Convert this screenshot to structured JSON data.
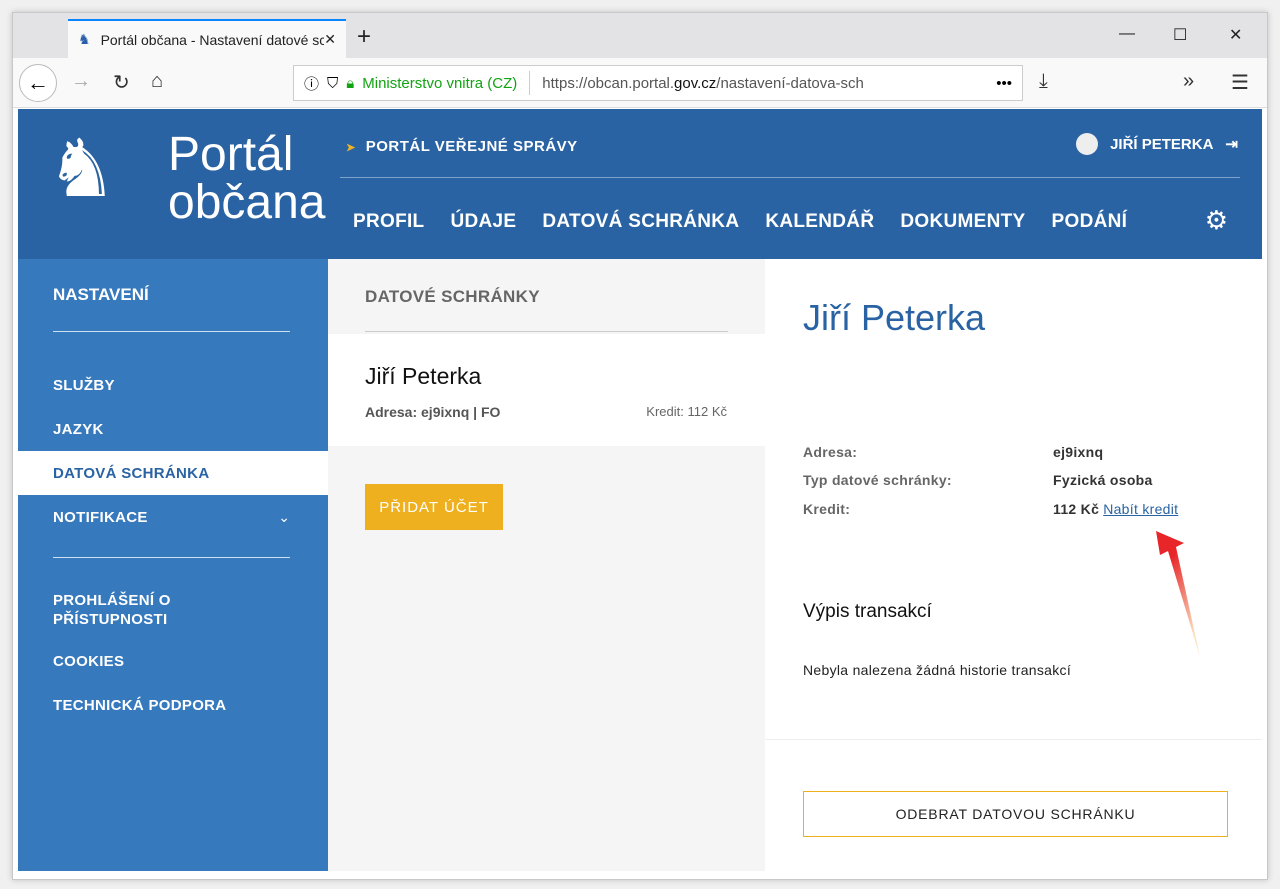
{
  "browser": {
    "tab_title": "Portál občana - Nastavení datové schránky",
    "url_org": "Ministerstvo vnitra (CZ)",
    "url_prefix": "https://obcan.portal.",
    "url_domain": "gov.cz",
    "url_path": "/nastavení-datova-sch"
  },
  "header": {
    "logo_line1": "Portál",
    "logo_line2": "občana",
    "portal_link": "PORTÁL VEŘEJNÉ SPRÁVY",
    "user_name": "JIŘÍ PETERKA",
    "menu": [
      "PROFIL",
      "ÚDAJE",
      "DATOVÁ SCHRÁNKA",
      "KALENDÁŘ",
      "DOKUMENTY",
      "PODÁNÍ"
    ]
  },
  "sidebar": {
    "title": "NASTAVENÍ",
    "items": [
      "SLUŽBY",
      "JAZYK",
      "DATOVÁ SCHRÁNKA",
      "NOTIFIKACE"
    ],
    "footer_items": [
      "PROHLÁŠENÍ O PŘÍSTUPNOSTI",
      "COOKIES",
      "TECHNICKÁ PODPORA"
    ]
  },
  "middle": {
    "title": "DATOVÉ SCHRÁNKY",
    "card_name": "Jiří Peterka",
    "card_address": "Adresa: ej9ixnq | FO",
    "card_credit": "Kredit: 112 Kč",
    "add_button": "PŘIDAT ÚČET"
  },
  "detail": {
    "name": "Jiří Peterka",
    "address_label": "Adresa:",
    "address_value": "ej9ixnq",
    "type_label": "Typ datové schránky:",
    "type_value": "Fyzická osoba",
    "credit_label": "Kredit:",
    "credit_value": "112 Kč",
    "credit_link": "Nabít kredit",
    "transactions_title": "Výpis transakcí",
    "transactions_empty": "Nebyla nalezena žádná historie transakcí",
    "remove_button": "ODEBRAT DATOVOU SCHRÁNKU"
  }
}
